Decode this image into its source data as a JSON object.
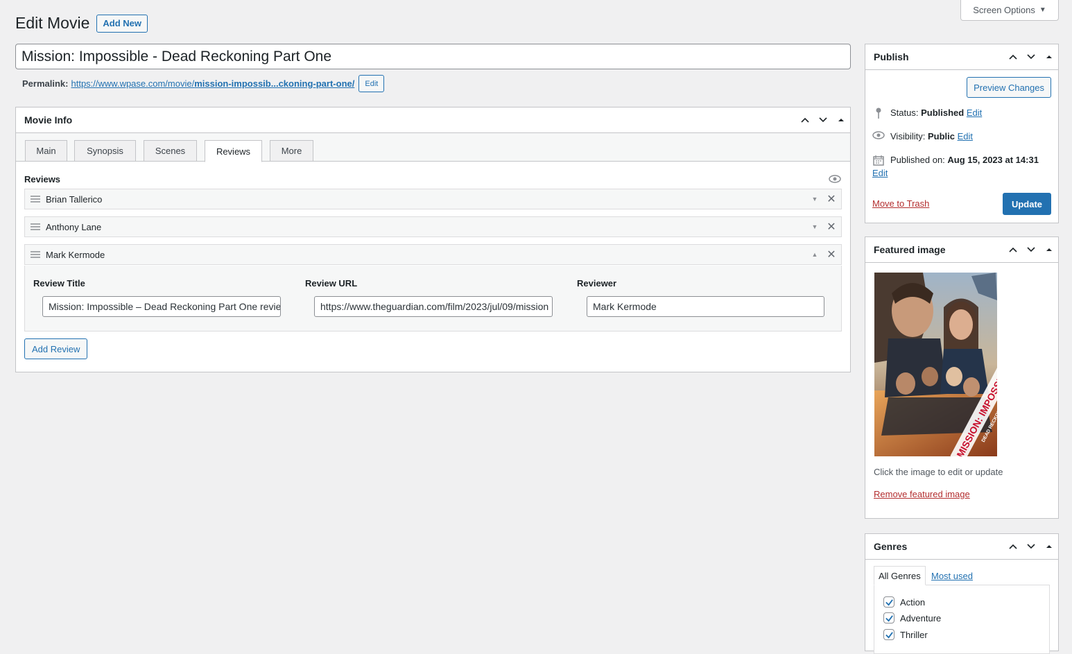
{
  "screen_options": {
    "label": "Screen Options"
  },
  "header": {
    "title": "Edit Movie",
    "add_new": "Add New"
  },
  "post_title": {
    "value": "Mission: Impossible - Dead Reckoning Part One"
  },
  "permalink": {
    "label": "Permalink:",
    "url_base": "https://www.wpase.com/movie/",
    "slug": "mission-impossib...ckoning-part-one/",
    "edit": "Edit"
  },
  "movie_info": {
    "title": "Movie Info",
    "tabs": [
      {
        "label": "Main",
        "active": false
      },
      {
        "label": "Synopsis",
        "active": false
      },
      {
        "label": "Scenes",
        "active": false
      },
      {
        "label": "Reviews",
        "active": true
      },
      {
        "label": "More",
        "active": false
      }
    ],
    "reviews_label": "Reviews",
    "rows": [
      {
        "name": "Brian Tallerico",
        "expanded": false
      },
      {
        "name": "Anthony Lane",
        "expanded": false
      },
      {
        "name": "Mark Kermode",
        "expanded": true
      }
    ],
    "expanded_fields": {
      "review_title_label": "Review Title",
      "review_title_value": "Mission: Impossible – Dead Reckoning Part One review",
      "review_url_label": "Review URL",
      "review_url_value": "https://www.theguardian.com/film/2023/jul/09/mission",
      "reviewer_label": "Reviewer",
      "reviewer_value": "Mark Kermode"
    },
    "add_review": "Add Review"
  },
  "publish": {
    "title": "Publish",
    "preview": "Preview Changes",
    "status_label": "Status:",
    "status_value": "Published",
    "visibility_label": "Visibility:",
    "visibility_value": "Public",
    "published_label": "Published on:",
    "published_value": "Aug 15, 2023 at 14:31",
    "edit": "Edit",
    "trash": "Move to Trash",
    "update": "Update"
  },
  "featured_image": {
    "title": "Featured image",
    "hint": "Click the image to edit or update",
    "remove": "Remove featured image",
    "poster_text_1": "MISSION: IMPOSSIBLE",
    "poster_text_2": "DEAD RECKONING"
  },
  "genres": {
    "title": "Genres",
    "tab_all": "All Genres",
    "tab_used": "Most used",
    "items": [
      {
        "label": "Action",
        "checked": true
      },
      {
        "label": "Adventure",
        "checked": true
      },
      {
        "label": "Thriller",
        "checked": true
      }
    ]
  },
  "colors": {
    "accent": "#2271b1",
    "danger": "#b32d2e",
    "background": "#f0f0f1"
  }
}
